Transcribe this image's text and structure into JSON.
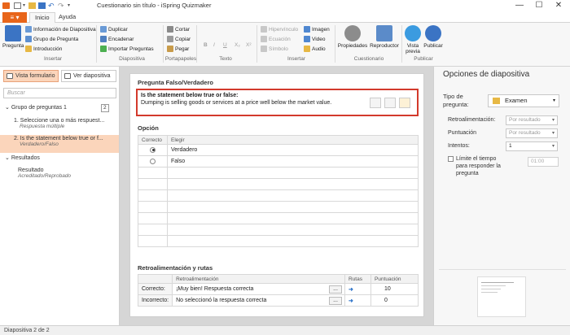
{
  "window": {
    "title": "Cuestionario sin título - iSpring Quizmaker",
    "controls": {
      "minimize": "—",
      "maximize": "☐",
      "close": "✕"
    }
  },
  "tabs": {
    "file": "≡ ▾",
    "home": "Inicio",
    "help": "Ayuda"
  },
  "ribbon": {
    "insertar": {
      "pregunta": "Pregunta",
      "info_diapositiva": "Información de Diapositiva",
      "grupo_pregunta": "Grupo de Pregunta",
      "introduccion": "Introducción",
      "group_label": "Insertar"
    },
    "diapositiva": {
      "duplicar": "Duplicar",
      "encadenar": "Encadenar",
      "importar": "Importar Preguntas",
      "group_label": "Diapositiva"
    },
    "portapapeles": {
      "cortar": "Cortar",
      "copiar": "Copiar",
      "pegar": "Pegar",
      "group_label": "Portapapeles"
    },
    "texto": {
      "bold": "B",
      "italic": "I",
      "underline": "U",
      "sub": "X₂",
      "sup": "X²",
      "group_label": "Texto"
    },
    "insertar2": {
      "hipervinculo": "Hipervínculo",
      "ecuacion": "Ecuación",
      "simbolo": "Símbolo",
      "imagen": "Imagen",
      "video": "Video",
      "audio": "Audio",
      "group_label": "Insertar"
    },
    "cuestionario": {
      "propiedades": "Propiedades",
      "reproductor": "Reproductor",
      "group_label": "Cuestionario"
    },
    "publicar": {
      "vista_previa": "Vista previa",
      "publicar": "Publicar",
      "group_label": "Publicar"
    }
  },
  "left_panel": {
    "form_view": "Vista formulario",
    "slide_view": "Ver diapositiva",
    "search_placeholder": "Buscar",
    "group": {
      "label": "Grupo de preguntas 1",
      "count": "2"
    },
    "items": [
      {
        "title": "1. Seleccione una o más respuest...",
        "subtitle": "Respuesta múltiple"
      },
      {
        "title": "2. Is the statement below true or f...",
        "subtitle": "Verdadero/Falso"
      }
    ],
    "results": {
      "label": "Resultados",
      "item": "Resultado",
      "item_sub": "Acreditado/Reprobado"
    }
  },
  "editor": {
    "section_title": "Pregunta Falso/Verdadero",
    "question_title": "Is the statement below true or false:",
    "question_body": "Dumping is selling goods or services at a price well below the market value.",
    "options_title": "Opción",
    "options_headers": {
      "correct": "Correcto",
      "choose": "Elegir"
    },
    "options": [
      {
        "label": "Verdadero",
        "selected": true
      },
      {
        "label": "Falso",
        "selected": false
      }
    ],
    "feedback_title": "Retroalimentación y rutas",
    "feedback_headers": {
      "feedback": "Retroalimentación",
      "routes": "Rutas",
      "score": "Puntuación"
    },
    "feedback_rows": [
      {
        "label": "Correcto:",
        "text": "¡Muy bien! Respuesta correcta",
        "score": "10"
      },
      {
        "label": "Incorrecto:",
        "text": "No seleccionó la respuesta correcta",
        "score": "0"
      }
    ],
    "more": "...",
    "route_icon": "➜"
  },
  "right_panel": {
    "title": "Opciones de diapositiva",
    "question_type_label": "Tipo de pregunta:",
    "question_type_value": "Examen",
    "feedback_label": "Retroalimentación:",
    "feedback_value": "Por resultado",
    "score_label": "Puntuación",
    "score_value": "Por resultado",
    "attempts_label": "Intentos:",
    "attempts_value": "1",
    "time_limit_label": "Límite el tiempo para responder la pregunta",
    "time_value": "01:00"
  },
  "status": {
    "text": "Diapositiva 2 de 2"
  },
  "colors": {
    "accent": "#e8651a",
    "highlight": "#fbd5bb",
    "red_border": "#d33a2c"
  }
}
